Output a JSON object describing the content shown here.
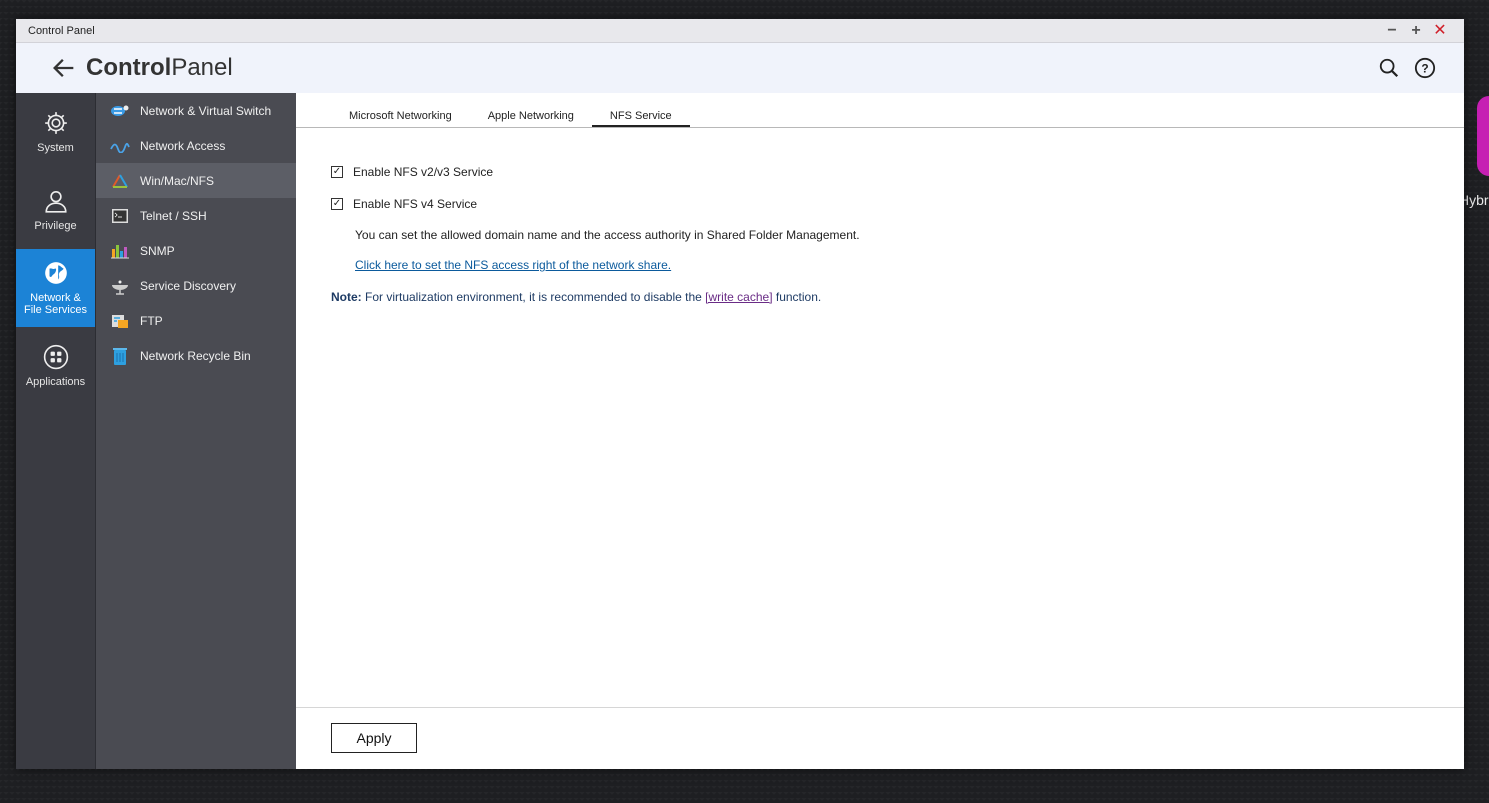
{
  "desktop": {
    "side_label": "Hybr"
  },
  "window": {
    "title": "Control Panel",
    "controls": {
      "minimize": "−",
      "maximize": "+",
      "close": "✕"
    }
  },
  "header": {
    "title_bold": "Control",
    "title_light": "Panel"
  },
  "nav_primary": [
    {
      "label": "System",
      "icon": "gear-icon"
    },
    {
      "label": "Privilege",
      "icon": "user-icon"
    },
    {
      "label": "Network &\nFile Services",
      "icon": "globe-icon",
      "active": true
    },
    {
      "label": "Applications",
      "icon": "apps-icon"
    }
  ],
  "nav_secondary": [
    {
      "label": "Network & Virtual Switch",
      "icon": "network-switch-icon"
    },
    {
      "label": "Network Access",
      "icon": "network-access-icon"
    },
    {
      "label": "Win/Mac/NFS",
      "icon": "win-mac-nfs-icon",
      "active": true
    },
    {
      "label": "Telnet / SSH",
      "icon": "terminal-icon"
    },
    {
      "label": "SNMP",
      "icon": "snmp-icon"
    },
    {
      "label": "Service Discovery",
      "icon": "satellite-icon"
    },
    {
      "label": "FTP",
      "icon": "ftp-icon"
    },
    {
      "label": "Network Recycle Bin",
      "icon": "recycle-bin-icon"
    }
  ],
  "tabs": [
    {
      "label": "Microsoft Networking"
    },
    {
      "label": "Apple Networking"
    },
    {
      "label": "NFS Service",
      "active": true
    }
  ],
  "nfs": {
    "v2v3_label": "Enable NFS v2/v3 Service",
    "v2v3_checked": true,
    "v4_label": "Enable NFS v4 Service",
    "v4_checked": true,
    "info": "You can set the allowed domain name and the access authority in Shared Folder Management.",
    "link": "Click here to set the NFS access right of the network share.",
    "note_prefix": "Note:",
    "note_text": " For virtualization environment, it is recommended to disable the ",
    "note_link": "[write cache]",
    "note_suffix": " function."
  },
  "footer": {
    "apply_label": "Apply"
  },
  "colors": {
    "accent": "#1c83d6",
    "nav_dark": "#3a3b42",
    "nav_mid": "#4a4b52"
  }
}
